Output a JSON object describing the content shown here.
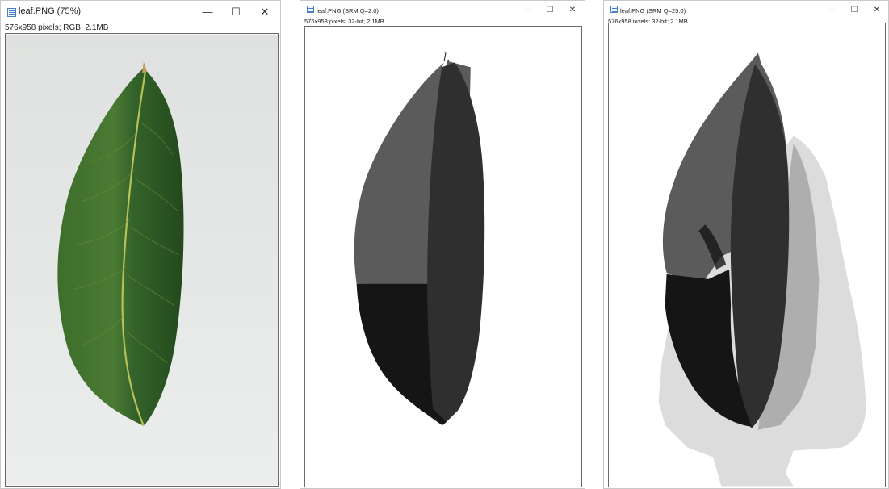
{
  "windows": [
    {
      "title": "leaf.PNG (75%)",
      "status": "576x958 pixels; RGB; 2.1MB",
      "controls": {
        "minimize": "—",
        "maximize": "☐",
        "close": "✕"
      }
    },
    {
      "title": "leaf.PNG (SRM Q=2.0)",
      "status": "576x958 pixels; 32-bit; 2.1MB",
      "controls": {
        "minimize": "—",
        "maximize": "☐",
        "close": "✕"
      }
    },
    {
      "title": "leaf.PNG (SRM Q=25.0)",
      "status": "576x958 pixels; 32-bit; 2.1MB",
      "controls": {
        "minimize": "—",
        "maximize": "☐",
        "close": "✕"
      }
    }
  ],
  "colors": {
    "leaf_dark": "#2e5a22",
    "leaf_mid": "#46772f",
    "midrib": "#b7c25a",
    "photo_bg": "#e5e7e6",
    "seg_dark_gray": "#5b5b5b",
    "seg_black": "#151515",
    "seg_charcoal": "#2f2f2f",
    "seg_light_bg": "#dcdcdc"
  }
}
